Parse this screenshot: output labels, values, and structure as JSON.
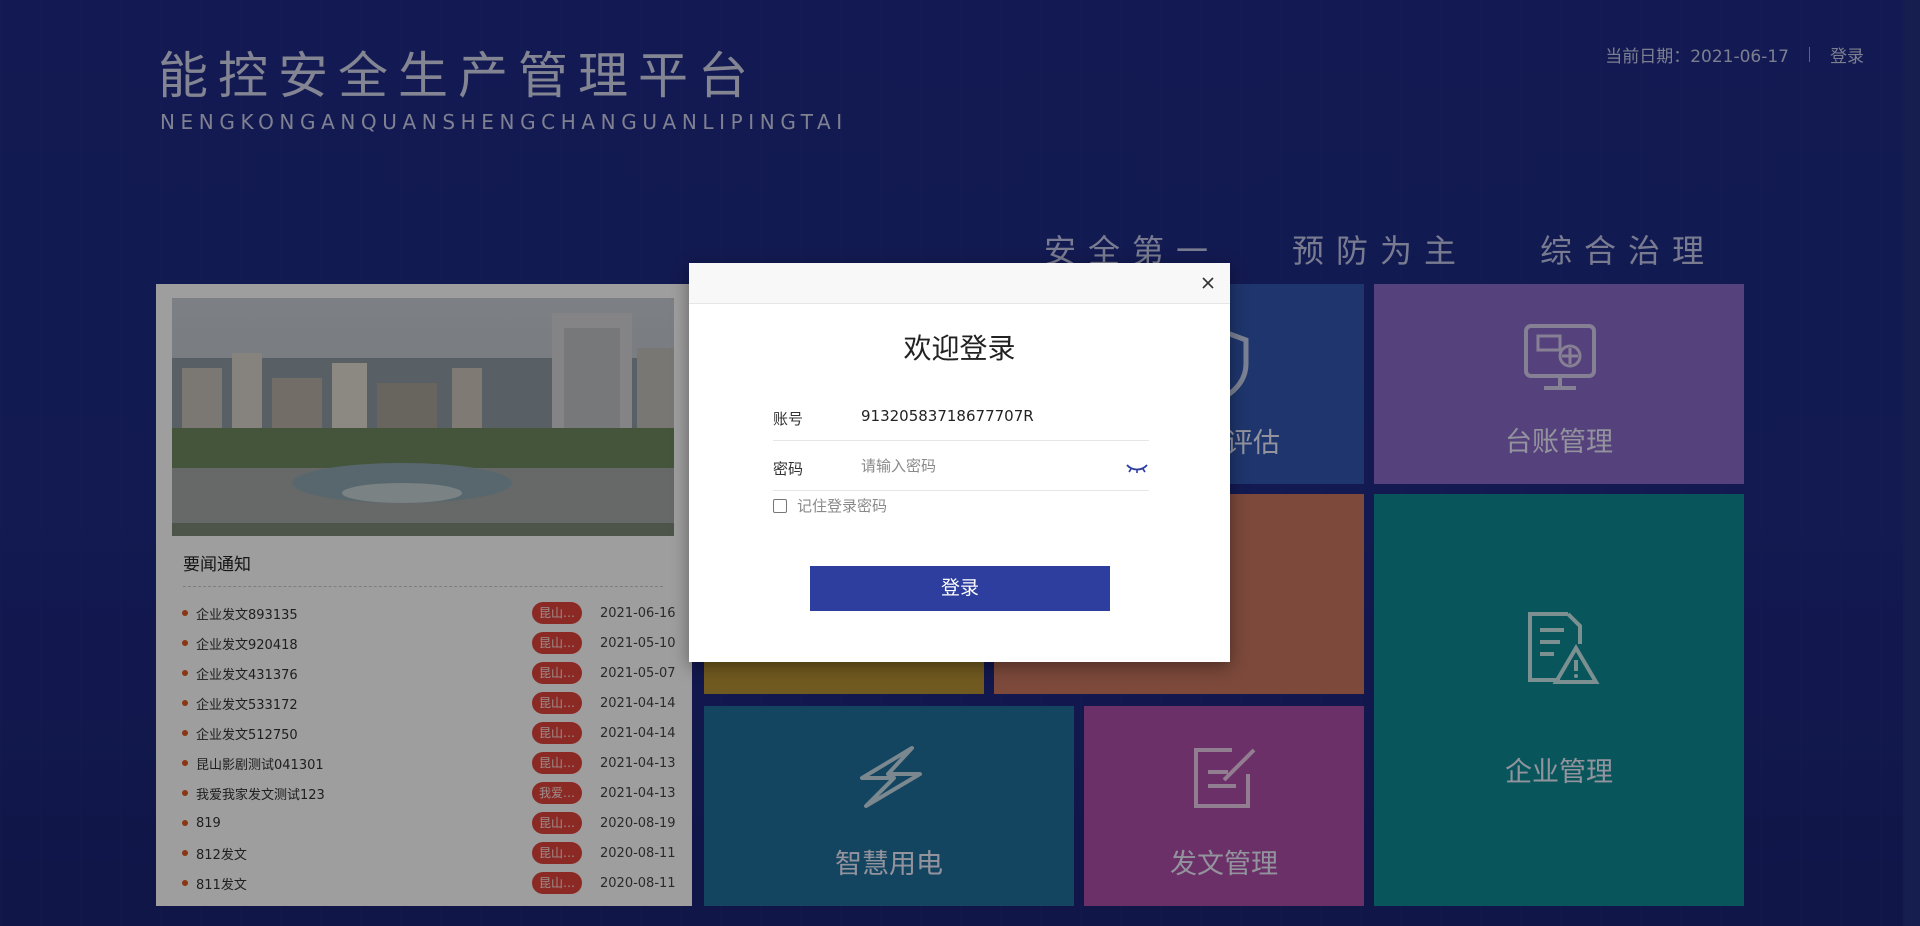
{
  "header": {
    "title": "能控安全生产管理平台",
    "subtitle": "NENGKONGANQUANSHENGCHANGUANLIPINGTAI",
    "date_text": "当前日期：2021-06-17",
    "login_link": "登录"
  },
  "slogans": [
    "安全第一",
    "预防为主",
    "综合治理"
  ],
  "news": {
    "heading": "要闻通知",
    "items": [
      {
        "title": "企业发文893135",
        "tag": "昆山…",
        "date": "2021-06-16"
      },
      {
        "title": "企业发文920418",
        "tag": "昆山…",
        "date": "2021-05-10"
      },
      {
        "title": "企业发文431376",
        "tag": "昆山…",
        "date": "2021-05-07"
      },
      {
        "title": "企业发文533172",
        "tag": "昆山…",
        "date": "2021-04-14"
      },
      {
        "title": "企业发文512750",
        "tag": "昆山…",
        "date": "2021-04-14"
      },
      {
        "title": "昆山影剧测试041301",
        "tag": "昆山…",
        "date": "2021-04-13"
      },
      {
        "title": "我爱我家发文测试123",
        "tag": "我爱…",
        "date": "2021-04-13"
      },
      {
        "title": "819",
        "tag": "昆山…",
        "date": "2020-08-19"
      },
      {
        "title": "812发文",
        "tag": "昆山…",
        "date": "2020-08-11"
      },
      {
        "title": "811发文",
        "tag": "昆山…",
        "date": "2020-08-11"
      }
    ]
  },
  "tiles": {
    "assessment": "评估",
    "ledger": "台账管理",
    "enterprise": "企业管理",
    "power": "智慧用电",
    "document": "发文管理"
  },
  "colors": {
    "ledger": "#8a69c7",
    "enterprise": "#0e8c93",
    "assessment": "#3157b0",
    "salmon": "#c9765f",
    "gold": "#b69234",
    "power": "#21709b",
    "document": "#ad4ea8",
    "primary": "#2e3e9e"
  },
  "modal": {
    "title": "欢迎登录",
    "account_label": "账号",
    "account_value": "91320583718677707R",
    "password_label": "密码",
    "password_placeholder": "请输入密码",
    "remember_label": "记住登录密码",
    "submit_label": "登录"
  }
}
